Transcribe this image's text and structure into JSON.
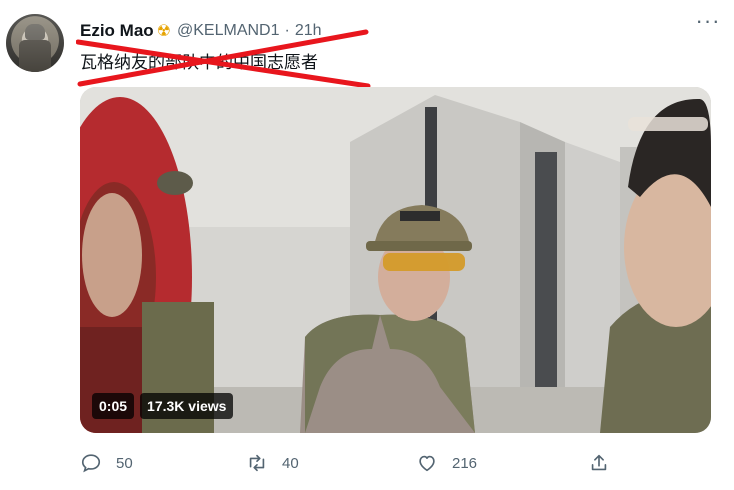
{
  "author": {
    "name": "Ezio Mao",
    "badge_icon": "radioactive-icon",
    "handle": "@KELMAND1",
    "separator": "·",
    "time": "21h"
  },
  "tweet": {
    "text": "瓦格纳友的部队中的中国志愿者",
    "struck_out": true,
    "strike_color": "#e8161d"
  },
  "media": {
    "type": "video",
    "duration": "0:05",
    "views": "17.3K views"
  },
  "actions": {
    "reply_count": "50",
    "retweet_count": "40",
    "like_count": "216",
    "more_label": "···"
  },
  "colors": {
    "text": "#0f1419",
    "muted": "#536471",
    "badge": "#e6a300"
  }
}
